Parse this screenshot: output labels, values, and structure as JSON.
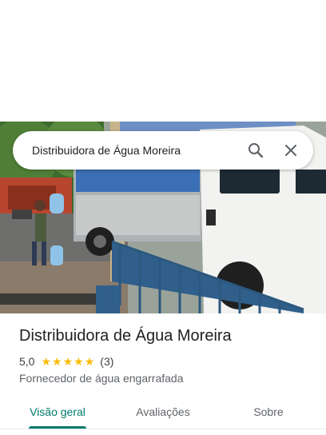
{
  "search": {
    "query": "Distribuidora de Água Moreira",
    "search_icon": "search-icon",
    "close_icon": "close-icon"
  },
  "place": {
    "name": "Distribuidora de Água Moreira",
    "rating": "5,0",
    "stars": 5,
    "review_count": "(3)",
    "category": "Fornecedor de água engarrafada"
  },
  "tabs": [
    {
      "label": "Visão geral",
      "active": true
    },
    {
      "label": "Avaliações",
      "active": false
    },
    {
      "label": "Sobre",
      "active": false
    }
  ],
  "colors": {
    "accent": "#00796b",
    "star": "#fbbc04"
  }
}
